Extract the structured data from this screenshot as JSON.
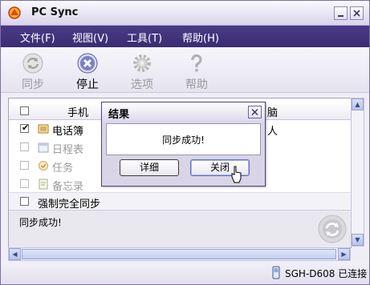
{
  "window": {
    "title": "PC Sync"
  },
  "menu": [
    {
      "label": "文件(F)"
    },
    {
      "label": "视图(V)"
    },
    {
      "label": "工具(T)"
    },
    {
      "label": "帮助(H)"
    }
  ],
  "toolbar": {
    "sync": "同步",
    "stop": "停止",
    "options": "选项",
    "help": "帮助"
  },
  "table": {
    "headers": {
      "phone": "手机",
      "pc": "脑"
    },
    "rows": [
      {
        "label": "电话簿",
        "checked": true,
        "enabled": true,
        "pc_value": "人"
      },
      {
        "label": "日程表",
        "checked": false,
        "enabled": false
      },
      {
        "label": "任务",
        "checked": false,
        "enabled": false
      },
      {
        "label": "备忘录",
        "checked": false,
        "enabled": false
      }
    ],
    "force_sync": "强制完全同步"
  },
  "status_message": "同步成功!",
  "dialog": {
    "title": "结果",
    "message": "同步成功!",
    "details_button": "详细",
    "close_button": "关闭"
  },
  "statusbar": {
    "device": "SGH-D608 已连接"
  },
  "colors": {
    "menubar": "#3b2d72",
    "accent": "#4a3a86"
  }
}
